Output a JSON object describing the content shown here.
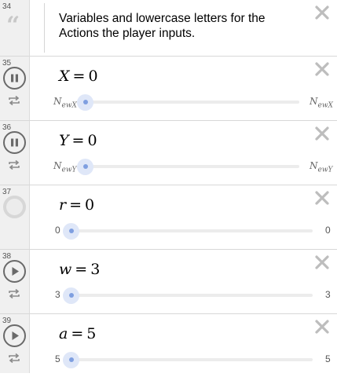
{
  "rows": [
    {
      "index": "34",
      "kind": "note",
      "text": "Variables and lowercase letters for the Actions the player inputs."
    },
    {
      "index": "35",
      "kind": "slider",
      "control": "pause",
      "variable": "X",
      "operator": "=",
      "value": "0",
      "min_main": "N",
      "min_sub": "ewX",
      "max_main": "N",
      "max_sub": "ewX",
      "slider_fraction": 0
    },
    {
      "index": "36",
      "kind": "slider",
      "control": "pause",
      "variable": "Y",
      "operator": "=",
      "value": "0",
      "min_main": "N",
      "min_sub": "ewY",
      "max_main": "N",
      "max_sub": "ewY",
      "slider_fraction": 0
    },
    {
      "index": "37",
      "kind": "slider",
      "control": "circle",
      "variable": "r",
      "operator": "=",
      "value": "0",
      "min": "0",
      "max": "0",
      "slider_fraction": 0
    },
    {
      "index": "38",
      "kind": "slider",
      "control": "play",
      "variable": "w",
      "operator": "=",
      "value": "3",
      "min": "3",
      "max": "3",
      "slider_fraction": 0
    },
    {
      "index": "39",
      "kind": "slider",
      "control": "play",
      "variable": "a",
      "operator": "=",
      "value": "5",
      "min": "5",
      "max": "5",
      "slider_fraction": 0
    }
  ],
  "colors": {
    "gutter": "#f0f0f0",
    "slider_accent": "#7f9fe0",
    "slider_halo": "#dfe7f8",
    "icon_gray": "#6a6a6a",
    "close_gray": "#bdbdbd"
  }
}
